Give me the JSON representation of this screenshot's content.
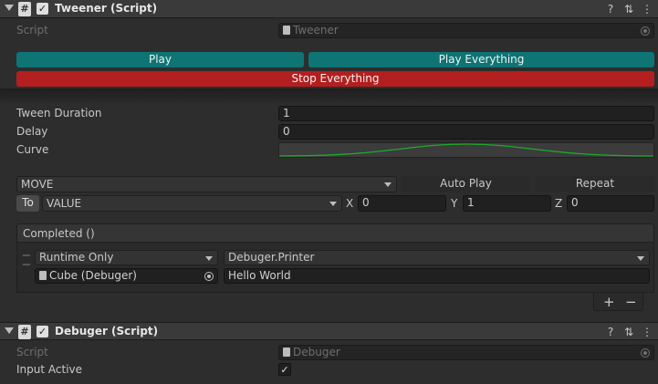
{
  "tweener": {
    "title": "Tweener (Script)",
    "script_label": "Script",
    "script_value": "Tweener",
    "play": "Play",
    "play_everything": "Play Everything",
    "stop_everything": "Stop Everything",
    "tween_duration_label": "Tween Duration",
    "tween_duration_value": "1",
    "delay_label": "Delay",
    "delay_value": "0",
    "curve_label": "Curve",
    "tween_type": "MOVE",
    "auto_play": "Auto Play",
    "repeat": "Repeat",
    "to_label": "To",
    "value_type": "VALUE",
    "x_label": "X",
    "x_value": "0",
    "y_label": "Y",
    "y_value": "1",
    "z_label": "Z",
    "z_value": "0",
    "event_header": "Completed ()",
    "runtime": "Runtime Only",
    "function": "Debuger.Printer",
    "target_object": "Cube (Debuger)",
    "argument": "Hello World",
    "plus": "+",
    "minus": "−"
  },
  "debuger": {
    "title": "Debuger (Script)",
    "script_label": "Script",
    "script_value": "Debuger",
    "input_active_label": "Input Active",
    "input_active_checked": true
  },
  "colors": {
    "play_teal": "#0e7474",
    "stop_red": "#b31f1f",
    "curve_green": "#1faa2a"
  }
}
